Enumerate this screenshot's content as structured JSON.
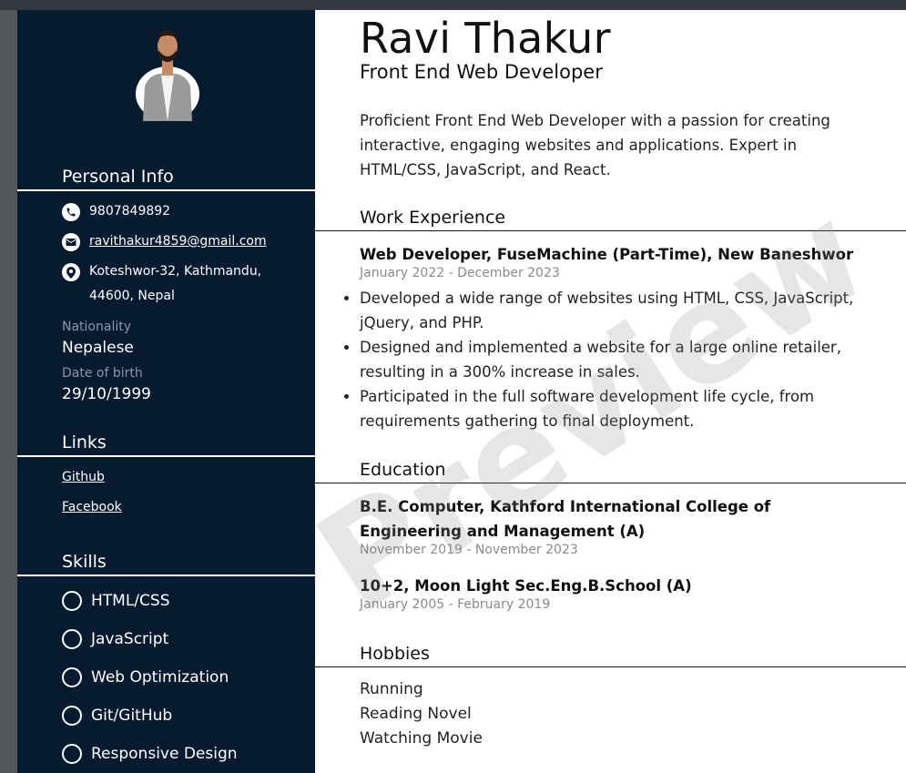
{
  "sidebar": {
    "personal_info": {
      "heading": "Personal Info",
      "phone": "9807849892",
      "email": "ravithakur4859@gmail.com",
      "address_line1": "Koteshwor-32, Kathmandu,",
      "address_line2": "44600, Nepal",
      "nationality_label": "Nationality",
      "nationality": "Nepalese",
      "dob_label": "Date of birth",
      "dob": "29/10/1999"
    },
    "links": {
      "heading": "Links",
      "items": [
        "Github",
        "Facebook"
      ]
    },
    "skills": {
      "heading": "Skills",
      "items": [
        "HTML/CSS",
        "JavaScript",
        "Web Optimization",
        "Git/GitHub",
        "Responsive Design"
      ]
    }
  },
  "main": {
    "name": "Ravi Thakur",
    "role": "Front End Web Developer",
    "summary": "Proficient Front End Web Developer with a passion for creating interactive, engaging websites and applications. Expert in HTML/CSS, JavaScript, and React.",
    "work": {
      "heading": "Work Experience",
      "title": "Web Developer, FuseMachine (Part-Time), New Baneshwor",
      "date": "January 2022 - December 2023",
      "bullets": [
        "Developed a wide range of websites using HTML, CSS, JavaScript, jQuery, and PHP.",
        "Designed and implemented a website for a large online retailer, resulting in a 300% increase in sales.",
        "Participated in the full software development life cycle, from requirements gathering to final deployment."
      ]
    },
    "education": {
      "heading": "Education",
      "items": [
        {
          "title": "B.E. Computer, Kathford International College of Engineering and Management (A)",
          "date": "November 2019 - November 2023"
        },
        {
          "title": "10+2, Moon Light Sec.Eng.B.School (A)",
          "date": "January 2005 - February 2019"
        }
      ]
    },
    "hobbies": {
      "heading": "Hobbies",
      "items": [
        "Running",
        "Reading Novel",
        "Watching Movie"
      ]
    }
  },
  "watermark": "Preview"
}
